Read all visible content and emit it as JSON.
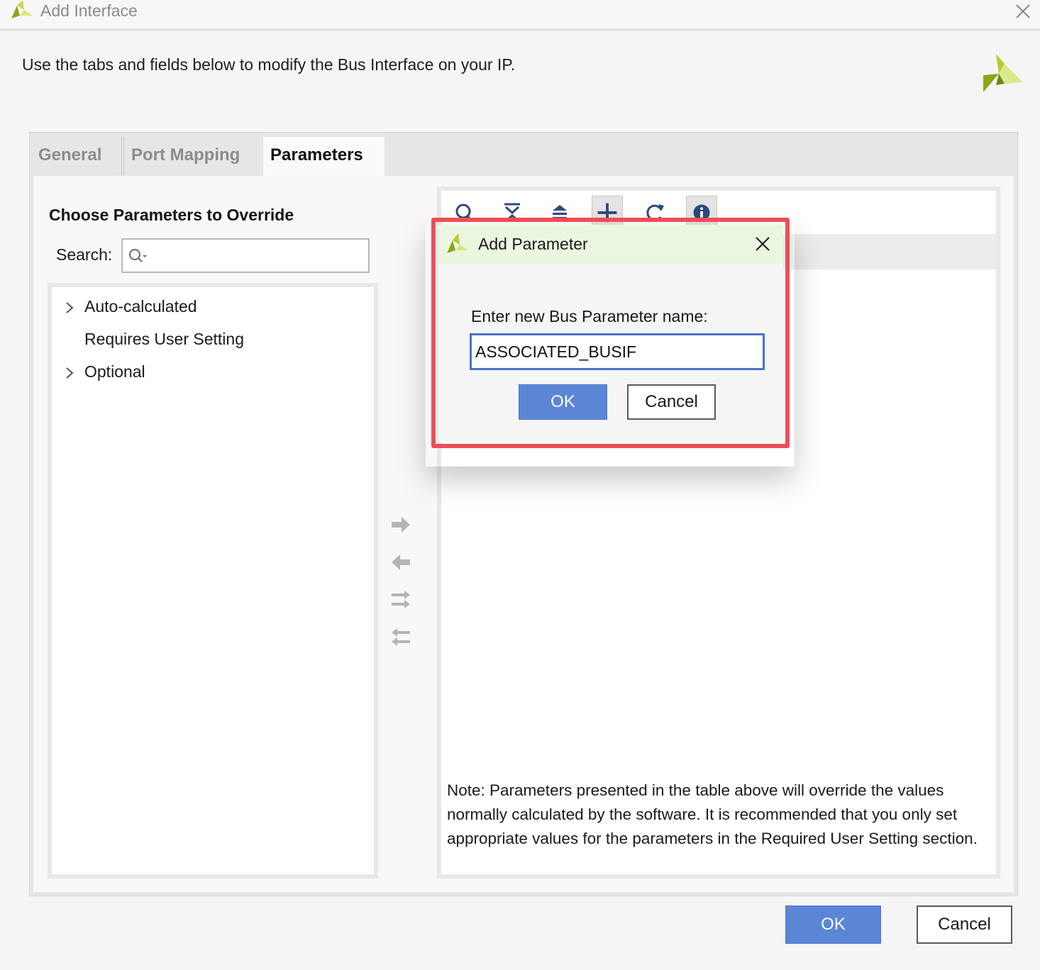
{
  "window": {
    "title": "Add Interface",
    "description": "Use the tabs and fields below to modify the Bus Interface on your IP."
  },
  "tabs": [
    {
      "label": "General",
      "active": false
    },
    {
      "label": "Port Mapping",
      "active": false
    },
    {
      "label": "Parameters",
      "active": true
    }
  ],
  "left_panel": {
    "title": "Choose Parameters to Override",
    "search_label": "Search:",
    "search_value": "",
    "tree": [
      {
        "label": "Auto-calculated",
        "expandable": true
      },
      {
        "label": "Requires User Setting",
        "expandable": false
      },
      {
        "label": "Optional",
        "expandable": true
      }
    ]
  },
  "transfer_buttons": [
    "arrow-right-icon",
    "arrow-left-icon",
    "move-all-right-icon",
    "move-all-left-icon"
  ],
  "toolbar": {
    "buttons": [
      "search-icon",
      "collapse-all-icon",
      "expand-all-icon",
      "add-icon",
      "refresh-icon",
      "info-icon"
    ]
  },
  "right_panel": {
    "note": "Note: Parameters presented in the table above will override the values normally calculated by the software. It is recommended that you only set appropriate values for the parameters in the Required User Setting section."
  },
  "footer": {
    "ok_label": "OK",
    "cancel_label": "Cancel"
  },
  "dialog": {
    "title": "Add Parameter",
    "prompt": "Enter new Bus Parameter name:",
    "input_value": "ASSOCIATED_BUSIF",
    "ok_label": "OK",
    "cancel_label": "Cancel"
  },
  "colors": {
    "primary_button": "#5b86d6",
    "highlight": "#ef4d56",
    "dialog_title_bg": "#eaf6df",
    "brand_green": "#8aa61c"
  }
}
